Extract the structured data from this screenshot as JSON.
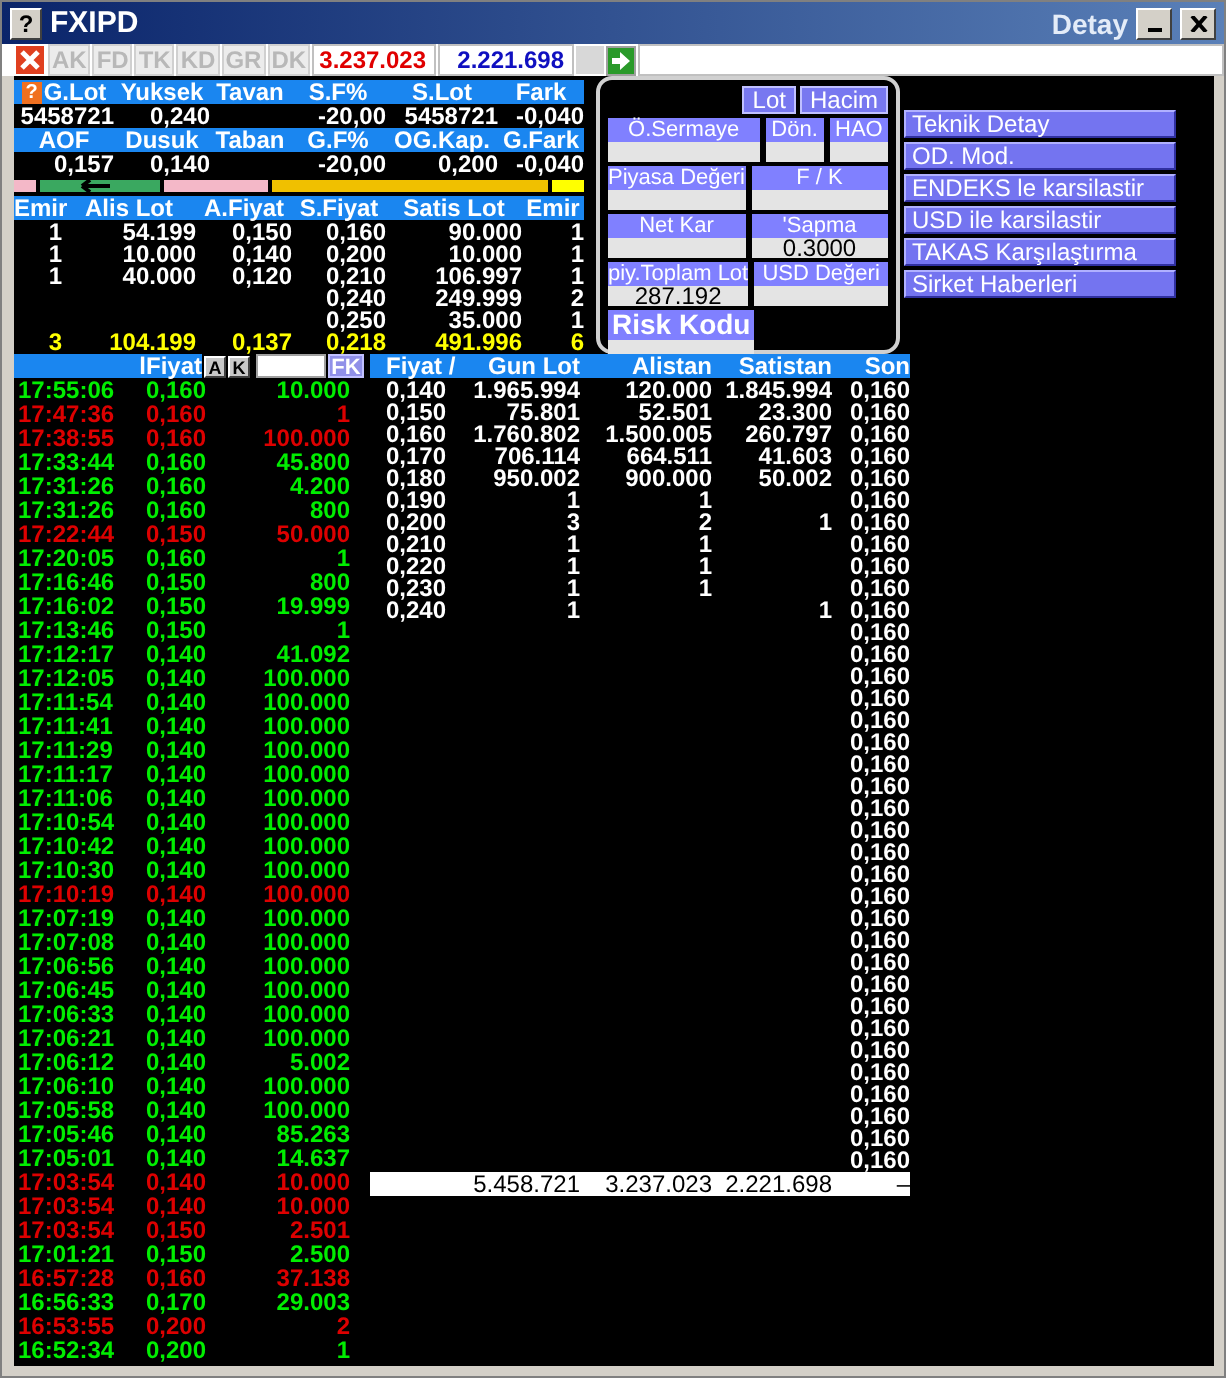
{
  "window": {
    "help_glyph": "?",
    "title": "FXIPD",
    "right_title": "Detay"
  },
  "toolbar": {
    "tabs": [
      "AK",
      "FD",
      "TK",
      "KD",
      "GR",
      "DK"
    ],
    "sell_volume": "3.237.023",
    "buy_volume": "2.221.698"
  },
  "summary": {
    "help_glyph": "?",
    "groups": [
      [
        {
          "header": "G.Lot",
          "value": "5458721"
        },
        {
          "header": "Yuksek",
          "value": "0,240"
        },
        {
          "header": "Tavan"
        },
        {
          "header": "S.F%",
          "value": "-20,00"
        },
        {
          "header": "S.Lot",
          "value": "5458721"
        },
        {
          "header": "Fark",
          "value": "-0,040"
        }
      ],
      [
        {
          "header": "AOF",
          "value": "0,157"
        },
        {
          "header": "Dusuk",
          "value": "0,140"
        },
        {
          "header": "Taban"
        },
        {
          "header": "G.F%",
          "value": "-20,00"
        },
        {
          "header": "OG.Kap.",
          "value": "0,200"
        },
        {
          "header": "G.Fark",
          "value": "-0,040"
        }
      ]
    ]
  },
  "order_book": {
    "columns": [
      "Emir",
      "Alis Lot",
      "A.Fiyat",
      "S.Fiyat",
      "Satis Lot",
      "Emir"
    ],
    "rows": [
      {
        "buy_orders": "1",
        "buy_lot": "54.199",
        "buy_price": "0,150",
        "sell_price": "0,160",
        "sell_lot": "90.000",
        "sell_orders": "1"
      },
      {
        "buy_orders": "1",
        "buy_lot": "10.000",
        "buy_price": "0,140",
        "sell_price": "0,200",
        "sell_lot": "10.000",
        "sell_orders": "1"
      },
      {
        "buy_orders": "1",
        "buy_lot": "40.000",
        "buy_price": "0,120",
        "sell_price": "0,210",
        "sell_lot": "106.997",
        "sell_orders": "1"
      },
      {
        "sell_price": "0,240",
        "sell_lot": "249.999",
        "sell_orders": "2"
      },
      {
        "sell_price": "0,250",
        "sell_lot": "35.000",
        "sell_orders": "1"
      }
    ],
    "totals": [
      "3",
      "104.199",
      "0,137",
      "0,218",
      "491.996",
      "6"
    ]
  },
  "fundamentals": {
    "toggles": [
      "Lot",
      "Hacim"
    ],
    "rows": [
      [
        {
          "label": "Ö.Sermaye",
          "kind": "field"
        },
        {
          "label": "Dön.",
          "kind": "field"
        },
        {
          "label": "HAO",
          "kind": "field"
        }
      ],
      [
        {
          "label": "Piyasa Değeri",
          "kind": "field"
        },
        {
          "label": "F / K",
          "kind": "field"
        }
      ],
      [
        {
          "label": "Net Kar",
          "kind": "field"
        },
        {
          "label": "'Sapma",
          "value": "0.3000",
          "kind": "field"
        }
      ],
      [
        {
          "label": "piy.Toplam Lot",
          "value": "287.192",
          "kind": "field"
        },
        {
          "label": "USD Değeri",
          "kind": "field"
        }
      ],
      [
        {
          "label": "Risk Kodu",
          "kind": "large"
        }
      ]
    ]
  },
  "menu": [
    "Teknik Detay",
    "OD. Mod.",
    "ENDEKS le karsilastir",
    "USD ile karsilastir",
    "TAKAS Karşılaştırma",
    "Sirket Haberleri"
  ],
  "trades": {
    "filter_label": "lFiyat",
    "buttons": [
      "A",
      "K"
    ],
    "fk_button": "FK",
    "rows": [
      {
        "time": "17:55:06",
        "price": "0,160",
        "lot": "10.000",
        "color": "#00ee00"
      },
      {
        "time": "17:47:36",
        "price": "0,160",
        "lot": "1",
        "color": "#dd0000"
      },
      {
        "time": "17:38:55",
        "price": "0,160",
        "lot": "100.000",
        "color": "#dd0000"
      },
      {
        "time": "17:33:44",
        "price": "0,160",
        "lot": "45.800",
        "color": "#00ee00"
      },
      {
        "time": "17:31:26",
        "price": "0,160",
        "lot": "4.200",
        "color": "#00ee00"
      },
      {
        "time": "17:31:26",
        "price": "0,160",
        "lot": "800",
        "color": "#00ee00"
      },
      {
        "time": "17:22:44",
        "price": "0,150",
        "lot": "50.000",
        "color": "#dd0000"
      },
      {
        "time": "17:20:05",
        "price": "0,160",
        "lot": "1",
        "color": "#00ee00"
      },
      {
        "time": "17:16:46",
        "price": "0,150",
        "lot": "800",
        "color": "#00ee00"
      },
      {
        "time": "17:16:02",
        "price": "0,150",
        "lot": "19.999",
        "color": "#00ee00"
      },
      {
        "time": "17:13:46",
        "price": "0,150",
        "lot": "1",
        "color": "#00ee00"
      },
      {
        "time": "17:12:17",
        "price": "0,140",
        "lot": "41.092",
        "color": "#00ee00"
      },
      {
        "time": "17:12:05",
        "price": "0,140",
        "lot": "100.000",
        "color": "#00ee00"
      },
      {
        "time": "17:11:54",
        "price": "0,140",
        "lot": "100.000",
        "color": "#00ee00"
      },
      {
        "time": "17:11:41",
        "price": "0,140",
        "lot": "100.000",
        "color": "#00ee00"
      },
      {
        "time": "17:11:29",
        "price": "0,140",
        "lot": "100.000",
        "color": "#00ee00"
      },
      {
        "time": "17:11:17",
        "price": "0,140",
        "lot": "100.000",
        "color": "#00ee00"
      },
      {
        "time": "17:11:06",
        "price": "0,140",
        "lot": "100.000",
        "color": "#00ee00"
      },
      {
        "time": "17:10:54",
        "price": "0,140",
        "lot": "100.000",
        "color": "#00ee00"
      },
      {
        "time": "17:10:42",
        "price": "0,140",
        "lot": "100.000",
        "color": "#00ee00"
      },
      {
        "time": "17:10:30",
        "price": "0,140",
        "lot": "100.000",
        "color": "#00ee00"
      },
      {
        "time": "17:10:19",
        "price": "0,140",
        "lot": "100.000",
        "color": "#dd0000"
      },
      {
        "time": "17:07:19",
        "price": "0,140",
        "lot": "100.000",
        "color": "#00ee00"
      },
      {
        "time": "17:07:08",
        "price": "0,140",
        "lot": "100.000",
        "color": "#00ee00"
      },
      {
        "time": "17:06:56",
        "price": "0,140",
        "lot": "100.000",
        "color": "#00ee00"
      },
      {
        "time": "17:06:45",
        "price": "0,140",
        "lot": "100.000",
        "color": "#00ee00"
      },
      {
        "time": "17:06:33",
        "price": "0,140",
        "lot": "100.000",
        "color": "#00ee00"
      },
      {
        "time": "17:06:21",
        "price": "0,140",
        "lot": "100.000",
        "color": "#00ee00"
      },
      {
        "time": "17:06:12",
        "price": "0,140",
        "lot": "5.002",
        "color": "#00ee00"
      },
      {
        "time": "17:06:10",
        "price": "0,140",
        "lot": "100.000",
        "color": "#00ee00"
      },
      {
        "time": "17:05:58",
        "price": "0,140",
        "lot": "100.000",
        "color": "#00ee00"
      },
      {
        "time": "17:05:46",
        "price": "0,140",
        "lot": "85.263",
        "color": "#00ee00"
      },
      {
        "time": "17:05:01",
        "price": "0,140",
        "lot": "14.637",
        "color": "#00ee00"
      },
      {
        "time": "17:03:54",
        "price": "0,140",
        "lot": "10.000",
        "color": "#dd0000"
      },
      {
        "time": "17:03:54",
        "price": "0,140",
        "lot": "10.000",
        "color": "#dd0000"
      },
      {
        "time": "17:03:54",
        "price": "0,150",
        "lot": "2.501",
        "color": "#dd0000"
      },
      {
        "time": "17:01:21",
        "price": "0,150",
        "lot": "2.500",
        "color": "#00ee00"
      },
      {
        "time": "16:57:28",
        "price": "0,160",
        "lot": "37.138",
        "color": "#dd0000"
      },
      {
        "time": "16:56:33",
        "price": "0,170",
        "lot": "29.003",
        "color": "#00ee00"
      },
      {
        "time": "16:53:55",
        "price": "0,200",
        "lot": "2",
        "color": "#dd0000"
      },
      {
        "time": "16:52:34",
        "price": "0,200",
        "lot": "1",
        "color": "#00ee00"
      }
    ]
  },
  "price_table": {
    "columns": [
      "Fiyat /",
      "Gun Lot",
      "Alistan",
      "Satistan",
      "Son"
    ],
    "rows": [
      {
        "fiyat": "0,140",
        "gun_lot": "1.965.994",
        "alistan": "120.000",
        "satistan": "1.845.994",
        "son": "0,160"
      },
      {
        "fiyat": "0,150",
        "gun_lot": "75.801",
        "alistan": "52.501",
        "satistan": "23.300",
        "son": "0,160"
      },
      {
        "fiyat": "0,160",
        "gun_lot": "1.760.802",
        "alistan": "1.500.005",
        "satistan": "260.797",
        "son": "0,160"
      },
      {
        "fiyat": "0,170",
        "gun_lot": "706.114",
        "alistan": "664.511",
        "satistan": "41.603",
        "son": "0,160"
      },
      {
        "fiyat": "0,180",
        "gun_lot": "950.002",
        "alistan": "900.000",
        "satistan": "50.002",
        "son": "0,160"
      },
      {
        "fiyat": "0,190",
        "gun_lot": "1",
        "alistan": "1",
        "son": "0,160"
      },
      {
        "fiyat": "0,200",
        "gun_lot": "3",
        "alistan": "2",
        "satistan": "1",
        "son": "0,160"
      },
      {
        "fiyat": "0,210",
        "gun_lot": "1",
        "alistan": "1",
        "son": "0,160"
      },
      {
        "fiyat": "0,220",
        "gun_lot": "1",
        "alistan": "1",
        "son": "0,160"
      },
      {
        "fiyat": "0,230",
        "gun_lot": "1",
        "alistan": "1",
        "son": "0,160"
      },
      {
        "fiyat": "0,240",
        "gun_lot": "1",
        "satistan": "1",
        "son": "0,160"
      },
      {
        "son": "0,160"
      },
      {
        "son": "0,160"
      },
      {
        "son": "0,160"
      },
      {
        "son": "0,160"
      },
      {
        "son": "0,160"
      },
      {
        "son": "0,160"
      },
      {
        "son": "0,160"
      },
      {
        "son": "0,160"
      },
      {
        "son": "0,160"
      },
      {
        "son": "0,160"
      },
      {
        "son": "0,160"
      },
      {
        "son": "0,160"
      },
      {
        "son": "0,160"
      },
      {
        "son": "0,160"
      },
      {
        "son": "0,160"
      },
      {
        "son": "0,160"
      },
      {
        "son": "0,160"
      },
      {
        "son": "0,160"
      },
      {
        "son": "0,160"
      },
      {
        "son": "0,160"
      },
      {
        "son": "0,160"
      },
      {
        "son": "0,160"
      },
      {
        "son": "0,160"
      },
      {
        "son": "0,160"
      },
      {
        "son": "0,160"
      }
    ],
    "totals": {
      "gun_lot": "5.458.721",
      "alistan": "3.237.023",
      "satistan": "2.221.698",
      "son": "–"
    }
  }
}
